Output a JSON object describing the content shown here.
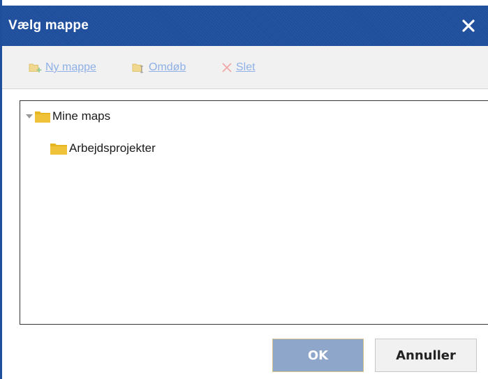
{
  "dialog": {
    "title": "Vælg mappe"
  },
  "toolbar": {
    "new_folder_label": "Ny mappe",
    "rename_label": "Omdøb",
    "delete_label": "Slet"
  },
  "tree": {
    "root": {
      "label": "Mine maps",
      "expanded": true,
      "icon": "folder-icon"
    },
    "children": [
      {
        "label": "Arbejdsprojekter",
        "icon": "folder-icon"
      }
    ]
  },
  "buttons": {
    "ok_label": "OK",
    "cancel_label": "Annuller"
  },
  "colors": {
    "titlebar": "#1f4e9c",
    "folder": "#e6b622",
    "toolbar_link_disabled": "#8fb0e6",
    "ok_disabled": "#8ea6c9"
  }
}
